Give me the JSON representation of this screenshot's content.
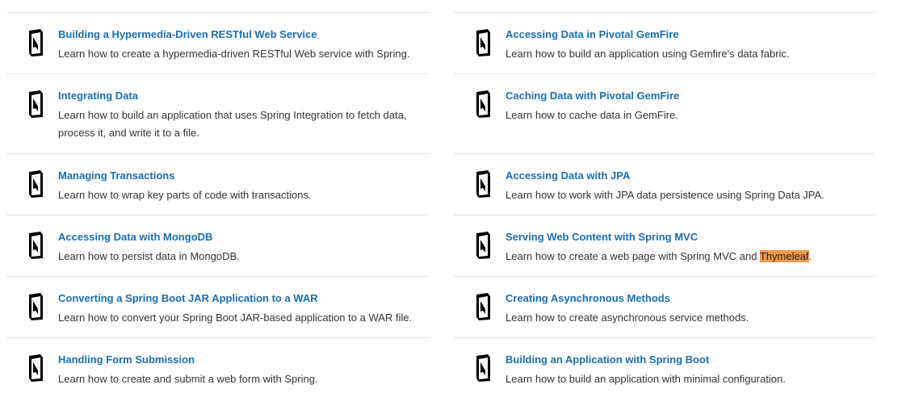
{
  "colors": {
    "link": "#1a6eb0",
    "text": "#333333",
    "divider": "#dde5e8",
    "highlight": "#f39a4c"
  },
  "icon": "book-icon",
  "left_column": [
    {
      "title": "Building a Hypermedia-Driven RESTful Web Service",
      "description": "Learn how to create a hypermedia-driven RESTful Web service with Spring."
    },
    {
      "title": "Integrating Data",
      "description": "Learn how to build an application that uses Spring Integration to fetch data, process it, and write it to a file."
    },
    {
      "title": "Managing Transactions",
      "description": "Learn how to wrap key parts of code with transactions."
    },
    {
      "title": "Accessing Data with MongoDB",
      "description": "Learn how to persist data in MongoDB."
    },
    {
      "title": "Converting a Spring Boot JAR Application to a WAR",
      "description": "Learn how to convert your Spring Boot JAR-based application to a WAR file."
    },
    {
      "title": "Handling Form Submission",
      "description": "Learn how to create and submit a web form with Spring."
    }
  ],
  "right_column": [
    {
      "title": "Accessing Data in Pivotal GemFire",
      "description": "Learn how to build an application using Gemfire's data fabric."
    },
    {
      "title": "Caching Data with Pivotal GemFire",
      "description": "Learn how to cache data in GemFire."
    },
    {
      "title": "Accessing Data with JPA",
      "description": "Learn how to work with JPA data persistence using Spring Data JPA."
    },
    {
      "title": "Serving Web Content with Spring MVC",
      "description_before": "Learn how to create a web page with Spring MVC and ",
      "description_highlight": "Thymeleaf",
      "description_after": "."
    },
    {
      "title": "Creating Asynchronous Methods",
      "description": "Learn how to create asynchronous service methods."
    },
    {
      "title": "Building an Application with Spring Boot",
      "description": "Learn how to build an application with minimal configuration."
    }
  ]
}
